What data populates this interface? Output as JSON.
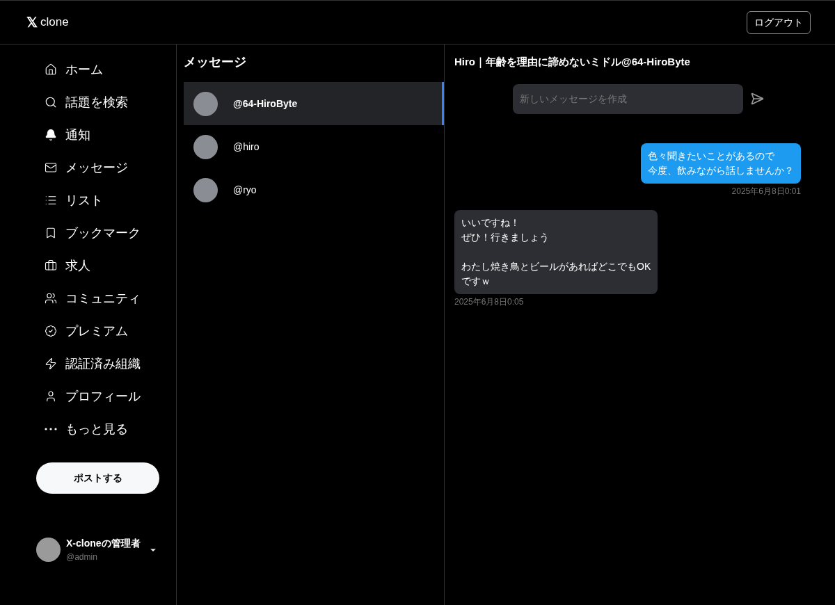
{
  "header": {
    "logo": "𝕏",
    "title": "clone",
    "logout": "ログアウト"
  },
  "nav": [
    {
      "label": "ホーム"
    },
    {
      "label": "話題を検索"
    },
    {
      "label": "通知"
    },
    {
      "label": "メッセージ"
    },
    {
      "label": "リスト"
    },
    {
      "label": "ブックマーク"
    },
    {
      "label": "求人"
    },
    {
      "label": "コミュニティ"
    },
    {
      "label": "プレミアム"
    },
    {
      "label": "認証済み組織"
    },
    {
      "label": "プロフィール"
    },
    {
      "label": "もっと見る"
    }
  ],
  "post_button": "ポストする",
  "account": {
    "name": "X-cloneの管理者",
    "handle": "@admin"
  },
  "conversations": {
    "title": "メッセージ",
    "items": [
      {
        "handle": "@64-HiroByte",
        "selected": true
      },
      {
        "handle": "@hiro",
        "selected": false
      },
      {
        "handle": "@ryo",
        "selected": false
      }
    ]
  },
  "chat": {
    "title": "Hiro｜年齢を理由に諦めないミドル@64-HiroByte",
    "composer": {
      "placeholder": "新しいメッセージを作成"
    },
    "messages": [
      {
        "kind": "sent",
        "paragraphs": [
          [
            "色々聞きたいことがあるので",
            "今度、飲みながら話しませんか？"
          ]
        ],
        "time": "2025年6月8日0:01"
      },
      {
        "kind": "received",
        "paragraphs": [
          [
            "いいですね！",
            "ぜひ！行きましょう"
          ],
          [
            "わたし焼き鳥とビールがあればどこでもOK",
            "ですｗ"
          ]
        ],
        "time": "2025年6月8日0:05"
      }
    ]
  }
}
